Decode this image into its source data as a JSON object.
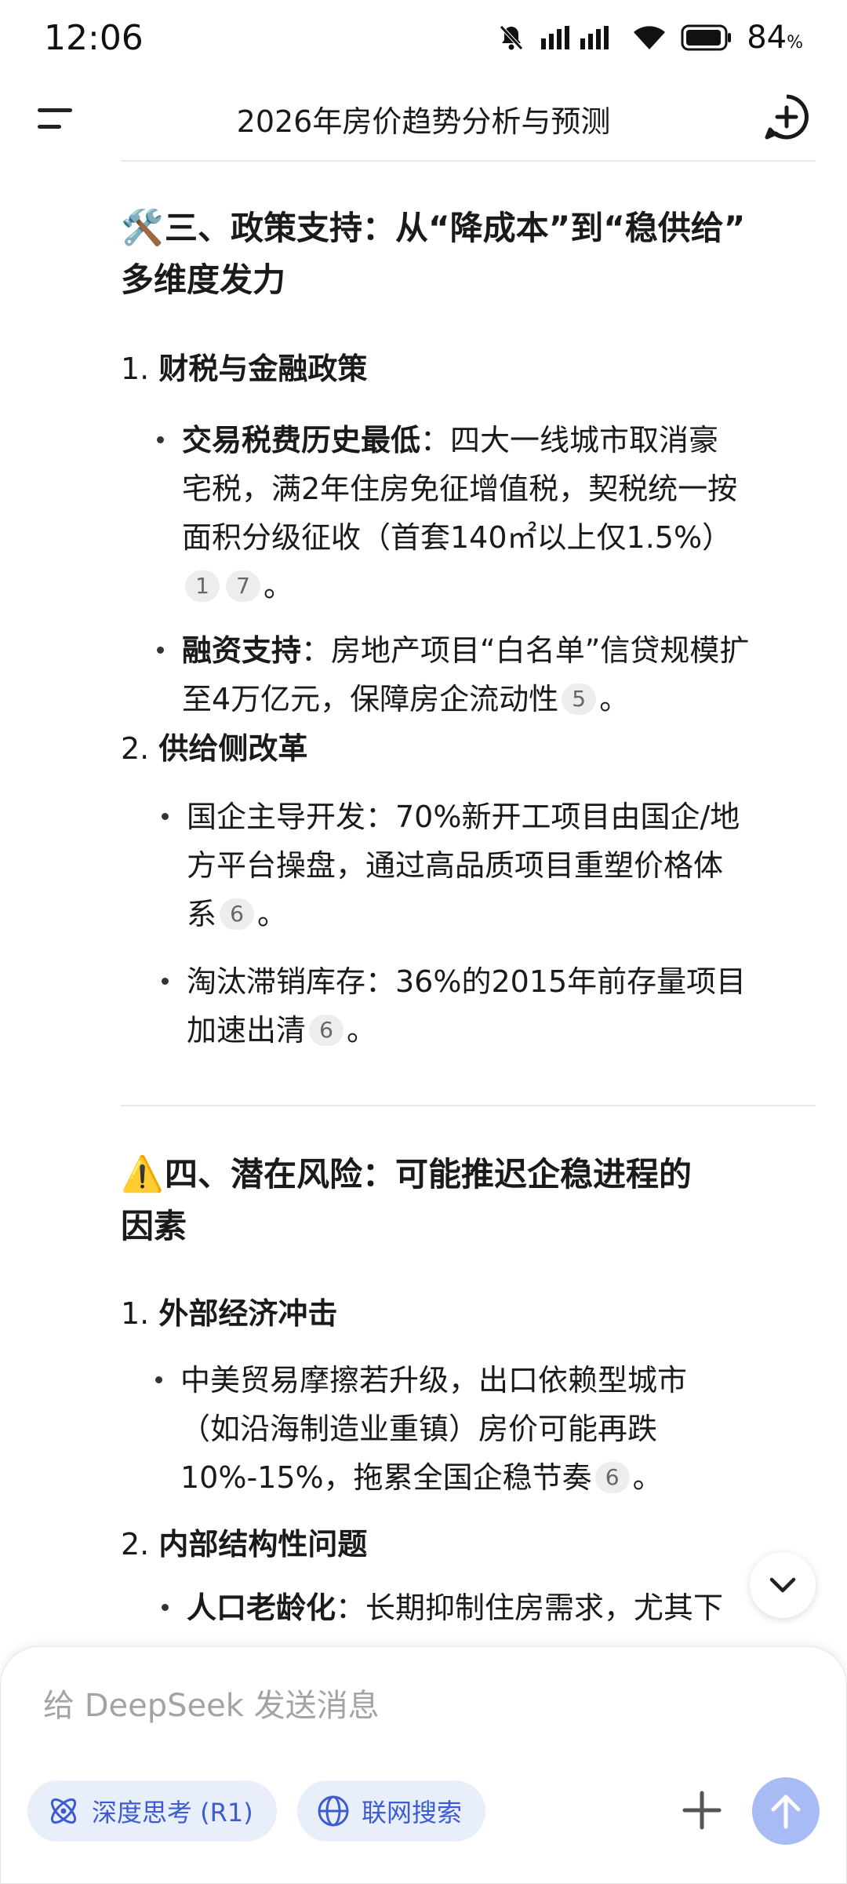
{
  "status_bar": {
    "time": "12:06",
    "battery": "84",
    "battery_unit": "%"
  },
  "header": {
    "title": "2026年房价趋势分析与预测"
  },
  "section3": {
    "emoji": "🛠️",
    "title_line1": "三、政策支持：从“降成本”到“稳供给”",
    "title_line2": "多维度发力",
    "items": [
      {
        "num": "1.",
        "title": "财税与金融政策",
        "bullets": [
          {
            "bold": "交易税费历史最低",
            "lines": [
              "：四大一线城市取消豪",
              "宅税，满2年住房免征增值税，契税统一按",
              "面积分级征收（首套140㎡以上仅1.5%）"
            ],
            "cites": [
              "1",
              "7"
            ],
            "end": "。"
          },
          {
            "bold": "融资支持",
            "lines": [
              "：房地产项目“白名单”信贷规模扩",
              "至4万亿元，保障房企流动性"
            ],
            "cites": [
              "5"
            ],
            "end": "。"
          }
        ]
      },
      {
        "num": "2.",
        "title": "供给侧改革",
        "bullets": [
          {
            "lines": [
              "国企主导开发：70%新开工项目由国企/地",
              "方平台操盘，通过高品质项目重塑价格体",
              "系"
            ],
            "cites": [
              "6"
            ],
            "end": "。"
          },
          {
            "lines": [
              "淘汰滞销库存：36%的2015年前存量项目",
              "加速出清"
            ],
            "cites": [
              "6"
            ],
            "end": "。"
          }
        ]
      }
    ]
  },
  "section4": {
    "emoji": "⚠️",
    "title_line1": "四、潜在风险：可能推迟企稳进程的",
    "title_line2": "因素",
    "items": [
      {
        "num": "1.",
        "title": "外部经济冲击",
        "bullets": [
          {
            "lines": [
              "中美贸易摩擦若升级，出口依赖型城市",
              "（如沿海制造业重镇）房价可能再跌",
              "10%-15%，拖累全国企稳节奏"
            ],
            "cites": [
              "6"
            ],
            "end": "。"
          }
        ]
      },
      {
        "num": "2.",
        "title": "内部结构性问题",
        "bullets": [
          {
            "bold": "人口老龄化",
            "lines": [
              "：长期抑制住房需求，尤其下"
            ]
          }
        ]
      }
    ]
  },
  "composer": {
    "placeholder": "给 DeepSeek 发送消息",
    "deep_think_label": "深度思考 (R1)",
    "web_search_label": "联网搜索"
  },
  "colors": {
    "accent": "#3c5ccf",
    "chip_bg": "#e9eefb",
    "send_bg": "#a8bbf5",
    "cite_bg": "#ededed"
  }
}
